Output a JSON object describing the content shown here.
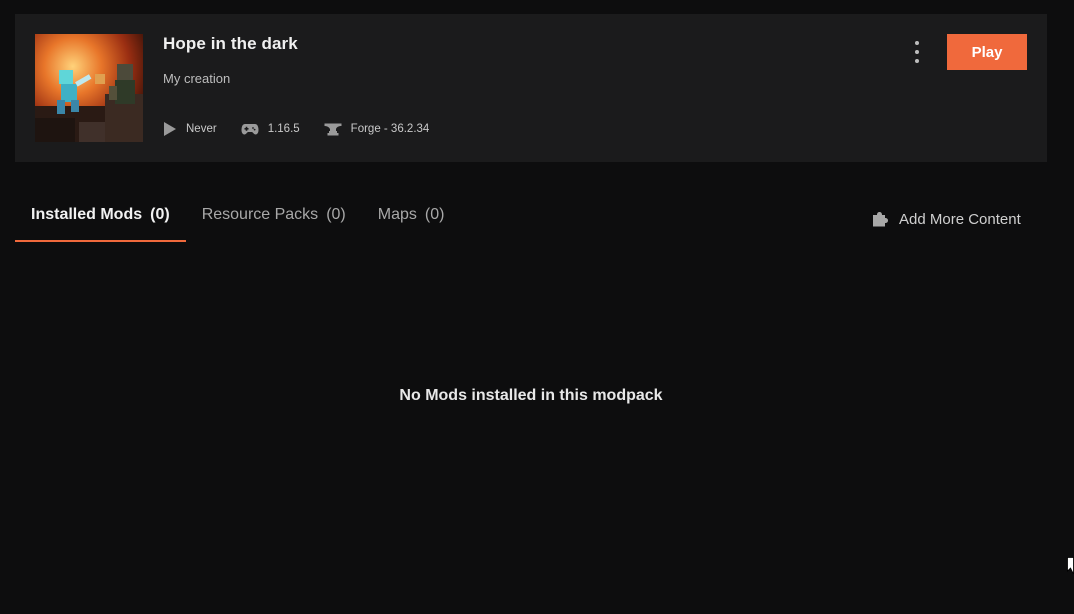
{
  "modpack": {
    "title": "Hope in the dark",
    "subtitle": "My creation",
    "last_played": "Never",
    "mc_version": "1.16.5",
    "loader": "Forge - 36.2.34",
    "thumbnail_icon": "minecraft-nether-artwork"
  },
  "actions": {
    "play_label": "Play",
    "menu_icon": "vertical-dots-icon"
  },
  "tabs": [
    {
      "label": "Installed Mods",
      "count": "(0)",
      "active": true
    },
    {
      "label": "Resource Packs",
      "count": "(0)",
      "active": false
    },
    {
      "label": "Maps",
      "count": "(0)",
      "active": false
    }
  ],
  "add_content": {
    "label": "Add More Content",
    "icon": "puzzle-piece-icon"
  },
  "empty_state": "No Mods installed in this modpack",
  "colors": {
    "accent": "#f0693c",
    "background": "#0d0d0e",
    "card": "#1b1b1c"
  }
}
